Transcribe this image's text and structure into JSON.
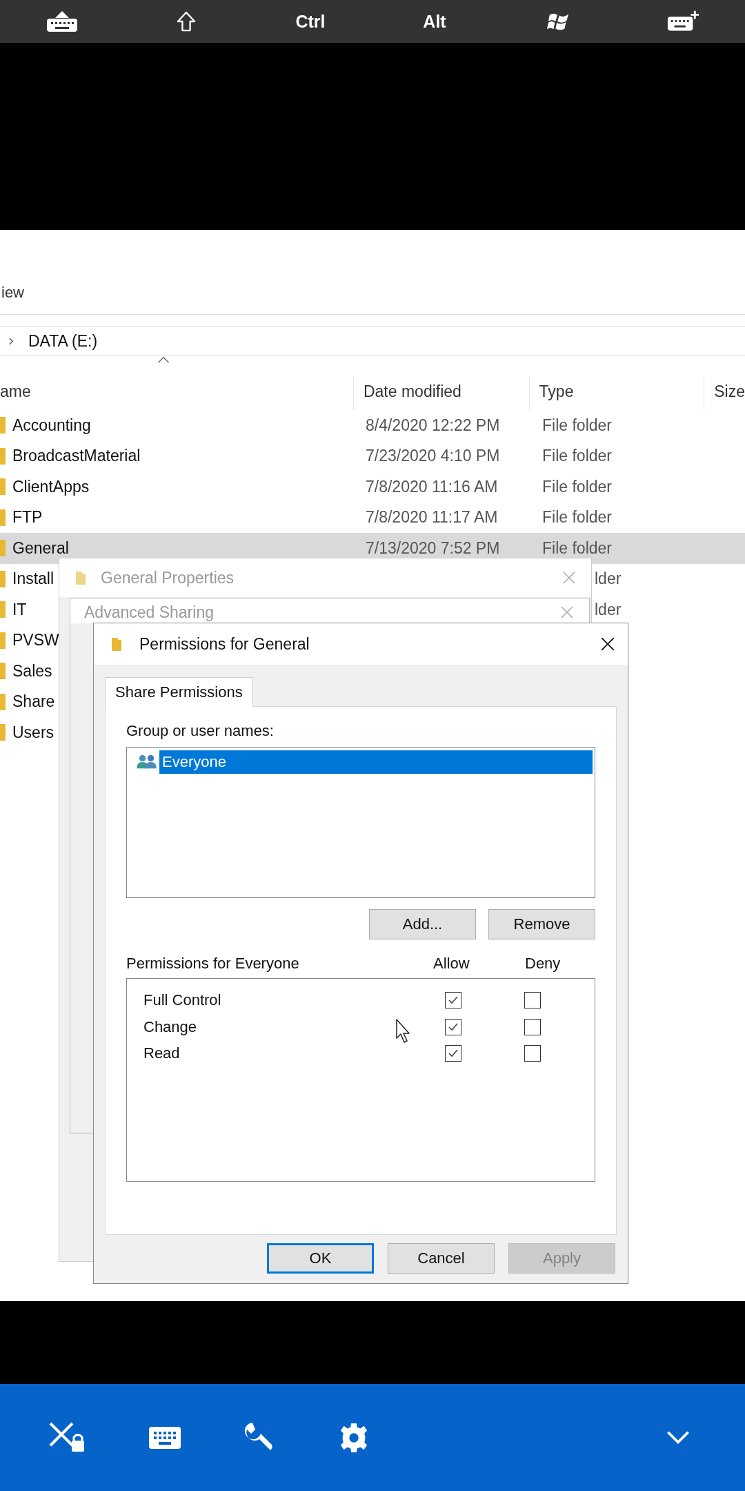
{
  "top_bar": {
    "keys": [
      "Ctrl",
      "Alt"
    ]
  },
  "explorer": {
    "menu_item": "iew",
    "breadcrumb": "DATA (E:)",
    "columns": [
      "ame",
      "Date modified",
      "Type",
      "Size"
    ],
    "rows": [
      {
        "name": "Accounting",
        "date": "8/4/2020 12:22 PM",
        "type": "File folder",
        "kind": "full",
        "selected": false
      },
      {
        "name": "BroadcastMaterial",
        "date": "7/23/2020 4:10 PM",
        "type": "File folder",
        "kind": "full",
        "selected": false
      },
      {
        "name": "ClientApps",
        "date": "7/8/2020 11:16 AM",
        "type": "File folder",
        "kind": "full",
        "selected": false
      },
      {
        "name": "FTP",
        "date": "7/8/2020 11:17 AM",
        "type": "File folder",
        "kind": "full",
        "selected": false
      },
      {
        "name": "General",
        "date": "7/13/2020 7:52 PM",
        "type": "File folder",
        "kind": "full",
        "selected": true
      },
      {
        "name": "Install",
        "type": "lder",
        "kind": "partial",
        "selected": false
      },
      {
        "name": "IT",
        "type": "lder",
        "kind": "partial",
        "selected": false
      },
      {
        "name": "PVSW",
        "kind": "partial",
        "selected": false
      },
      {
        "name": "Sales",
        "kind": "partial",
        "selected": false
      },
      {
        "name": "Share",
        "kind": "partial",
        "selected": false
      },
      {
        "name": "Users",
        "kind": "partial",
        "selected": false
      }
    ]
  },
  "general_properties": {
    "title": "General Properties"
  },
  "advanced_sharing": {
    "title": "Advanced Sharing"
  },
  "permissions_dialog": {
    "title": "Permissions for General",
    "tab": {
      "label": "Share Permissions",
      "selected": true
    },
    "group_label": "Group or user names:",
    "principals": [
      {
        "name": "Everyone",
        "selected": true
      }
    ],
    "list_buttons": [
      "Add...",
      "Remove"
    ],
    "permissions_label": "Permissions for Everyone",
    "allow_header": "Allow",
    "deny_header": "Deny",
    "permissions": [
      {
        "name": "Full Control",
        "allow": true,
        "deny": false
      },
      {
        "name": "Change",
        "allow": true,
        "deny": false
      },
      {
        "name": "Read",
        "allow": true,
        "deny": false
      }
    ],
    "footer_buttons": [
      {
        "label": "OK",
        "kind": "default"
      },
      {
        "label": "Cancel",
        "kind": "normal"
      },
      {
        "label": "Apply",
        "kind": "disabled"
      }
    ]
  }
}
